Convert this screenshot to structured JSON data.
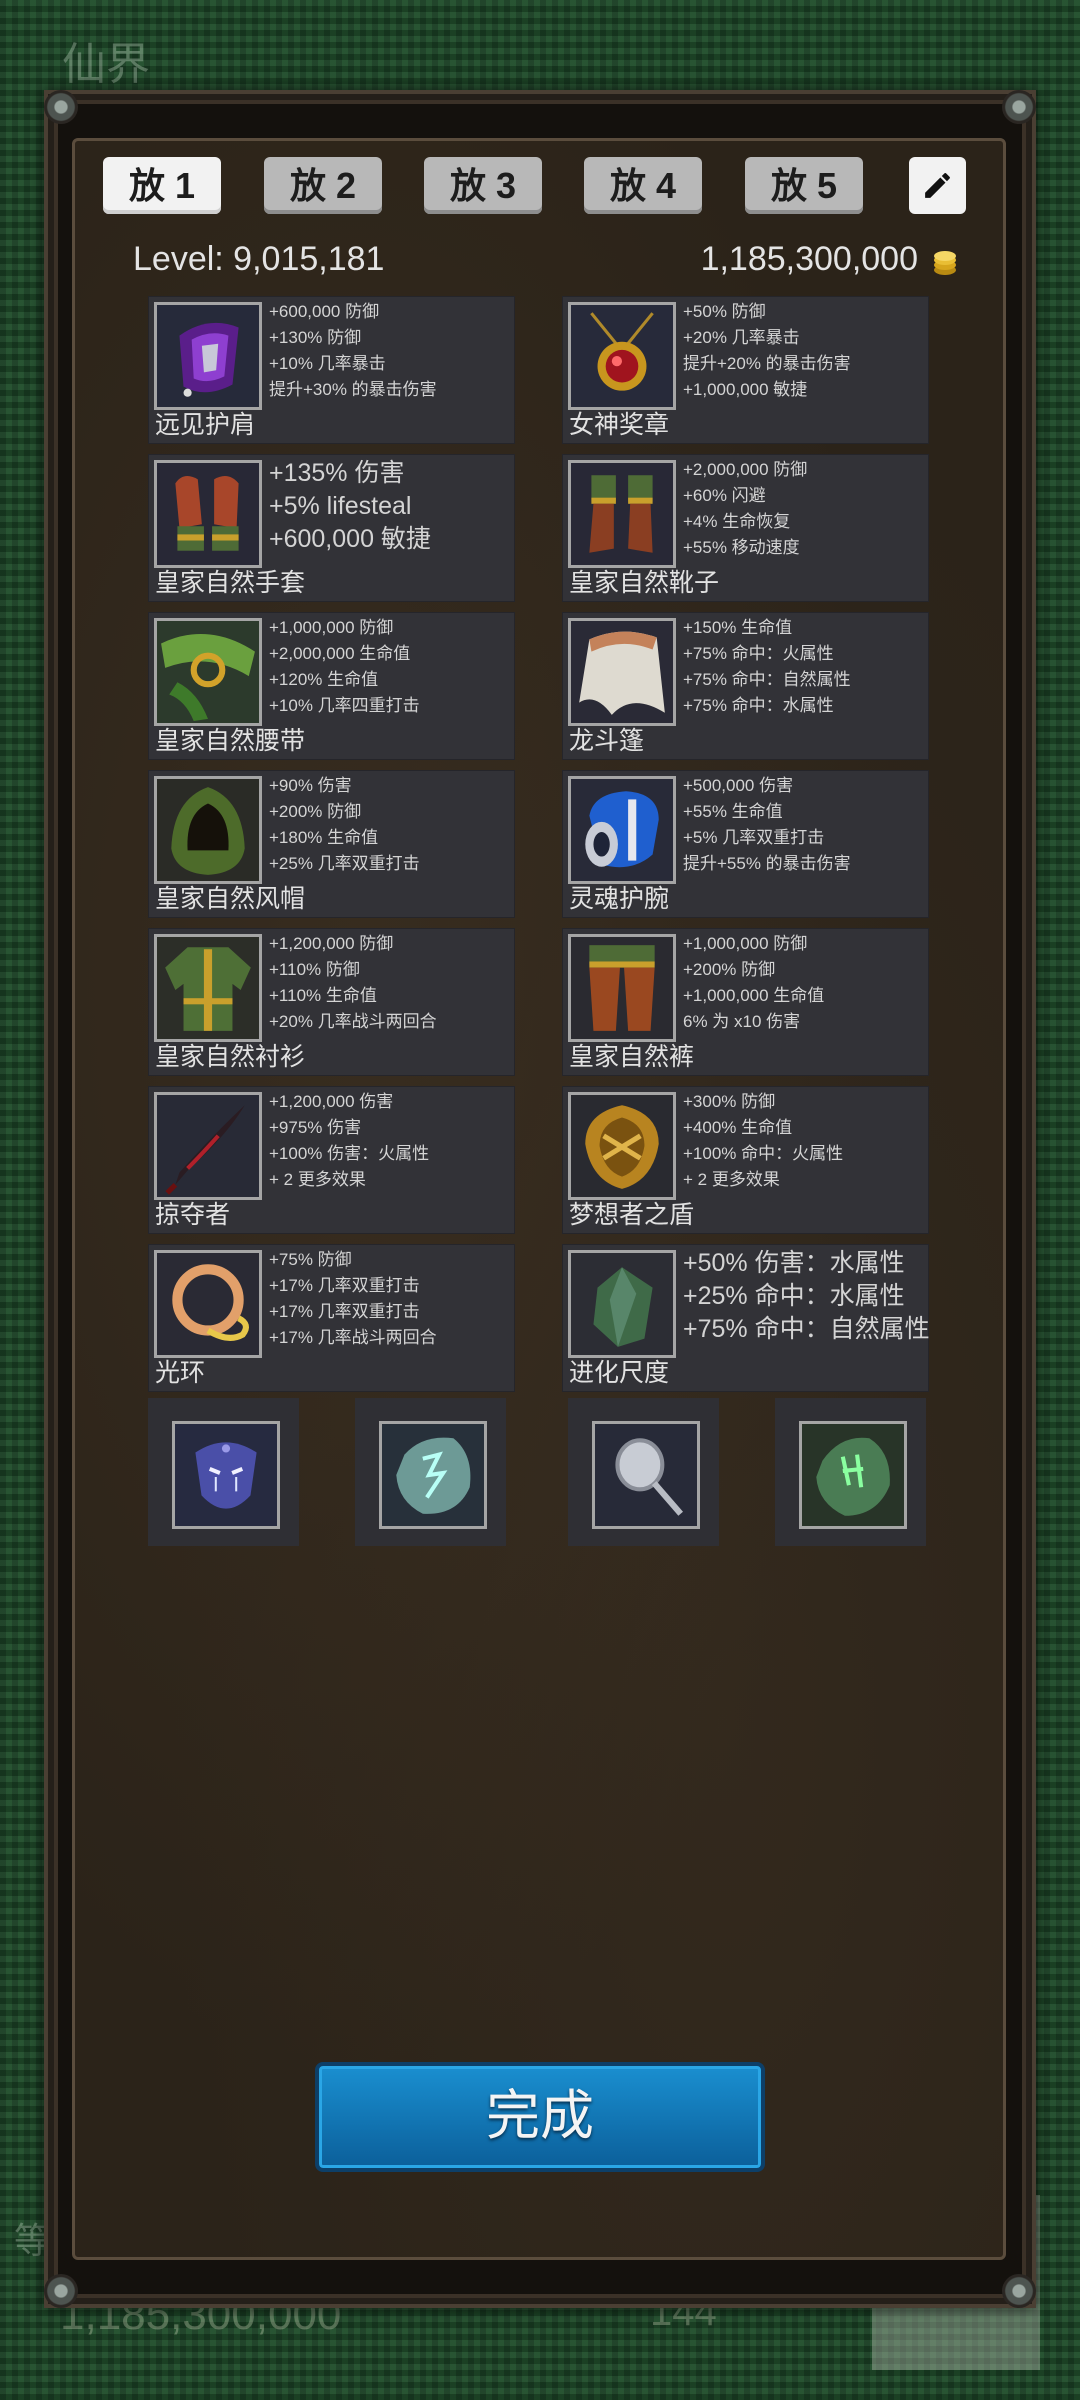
{
  "background": {
    "title": "仙界",
    "left_text": "等",
    "gold_amount": "1,185,300,000",
    "count": "144"
  },
  "tabs": [
    {
      "label": "放 1",
      "active": true
    },
    {
      "label": "放 2",
      "active": false
    },
    {
      "label": "放 3",
      "active": false
    },
    {
      "label": "放 4",
      "active": false
    },
    {
      "label": "放 5",
      "active": false
    }
  ],
  "edit_icon": "pencil-icon",
  "header": {
    "level": "Level:  9,015,181",
    "gold": "1,185,300,000",
    "gold_icon": "gold-coins-icon"
  },
  "equipment": [
    {
      "name": "远见护肩",
      "icon": "purple-shoulder-guard",
      "size": "small",
      "stats": [
        "+600,000 防御",
        "+130% 防御",
        "+10% 几率暴击",
        "提升+30% 的暴击伤害"
      ]
    },
    {
      "name": "女神奖章",
      "icon": "red-gem-medal",
      "size": "small",
      "stats": [
        "+50% 防御",
        "+20% 几率暴击",
        "提升+20% 的暴击伤害",
        "+1,000,000 敏捷"
      ]
    },
    {
      "name": "皇家自然手套",
      "icon": "gloves",
      "size": "large",
      "stats": [
        "+135% 伤害",
        "+5% lifesteal",
        "+600,000 敏捷"
      ]
    },
    {
      "name": "皇家自然靴子",
      "icon": "boots",
      "size": "small",
      "stats": [
        "+2,000,000 防御",
        "+60% 闪避",
        "+4% 生命恢复",
        "+55% 移动速度"
      ]
    },
    {
      "name": "皇家自然腰带",
      "icon": "green-belt",
      "size": "small",
      "stats": [
        "+1,000,000 防御",
        "+2,000,000 生命值",
        "+120% 生命值",
        "+10% 几率四重打击"
      ]
    },
    {
      "name": "龙斗篷",
      "icon": "cloak",
      "size": "small",
      "stats": [
        "+150% 生命值",
        "+75% 命中：火属性",
        "+75% 命中：自然属性",
        "+75% 命中：水属性"
      ]
    },
    {
      "name": "皇家自然风帽",
      "icon": "hood",
      "size": "small",
      "stats": [
        "+90% 伤害",
        "+200% 防御",
        "+180% 生命值",
        "+25% 几率双重打击"
      ]
    },
    {
      "name": "灵魂护腕",
      "icon": "blue-bracer",
      "size": "small",
      "stats": [
        "+500,000 伤害",
        "+55% 生命值",
        "+5% 几率双重打击",
        "提升+55% 的暴击伤害"
      ]
    },
    {
      "name": "皇家自然衬衫",
      "icon": "shirt",
      "size": "small",
      "stats": [
        "+1,200,000 防御",
        "+110% 防御",
        "+110% 生命值",
        "+20% 几率战斗两回合"
      ]
    },
    {
      "name": "皇家自然裤",
      "icon": "pants",
      "size": "small",
      "stats": [
        "+1,000,000 防御",
        "+200% 防御",
        "+1,000,000 生命值",
        "6% 为 x10 伤害"
      ]
    },
    {
      "name": "掠夺者",
      "icon": "dark-blade",
      "size": "small",
      "stats": [
        "+1,200,000 伤害",
        "+975% 伤害",
        "+100% 伤害：火属性",
        "+ 2 更多效果"
      ]
    },
    {
      "name": "梦想者之盾",
      "icon": "golden-shield",
      "size": "small",
      "stats": [
        "+300% 防御",
        "+400% 生命值",
        "+100% 命中：火属性",
        "+ 2 更多效果"
      ]
    },
    {
      "name": "光环",
      "icon": "halo-ring",
      "size": "small",
      "stats": [
        "+75% 防御",
        "+17% 几率双重打击",
        "+17% 几率双重打击",
        "+17% 几率战斗两回合"
      ]
    },
    {
      "name": "进化尺度",
      "icon": "green-scale",
      "size": "large",
      "stats": [
        "+50% 伤害：水属性",
        "+25% 命中：水属性",
        "+75% 命中：自然属性"
      ]
    }
  ],
  "runes": [
    {
      "icon": "crying-mask-icon"
    },
    {
      "icon": "blue-rune-stone-icon"
    },
    {
      "icon": "silver-mirror-icon"
    },
    {
      "icon": "green-rune-stone-icon"
    }
  ],
  "done_button": {
    "label": "完成"
  }
}
